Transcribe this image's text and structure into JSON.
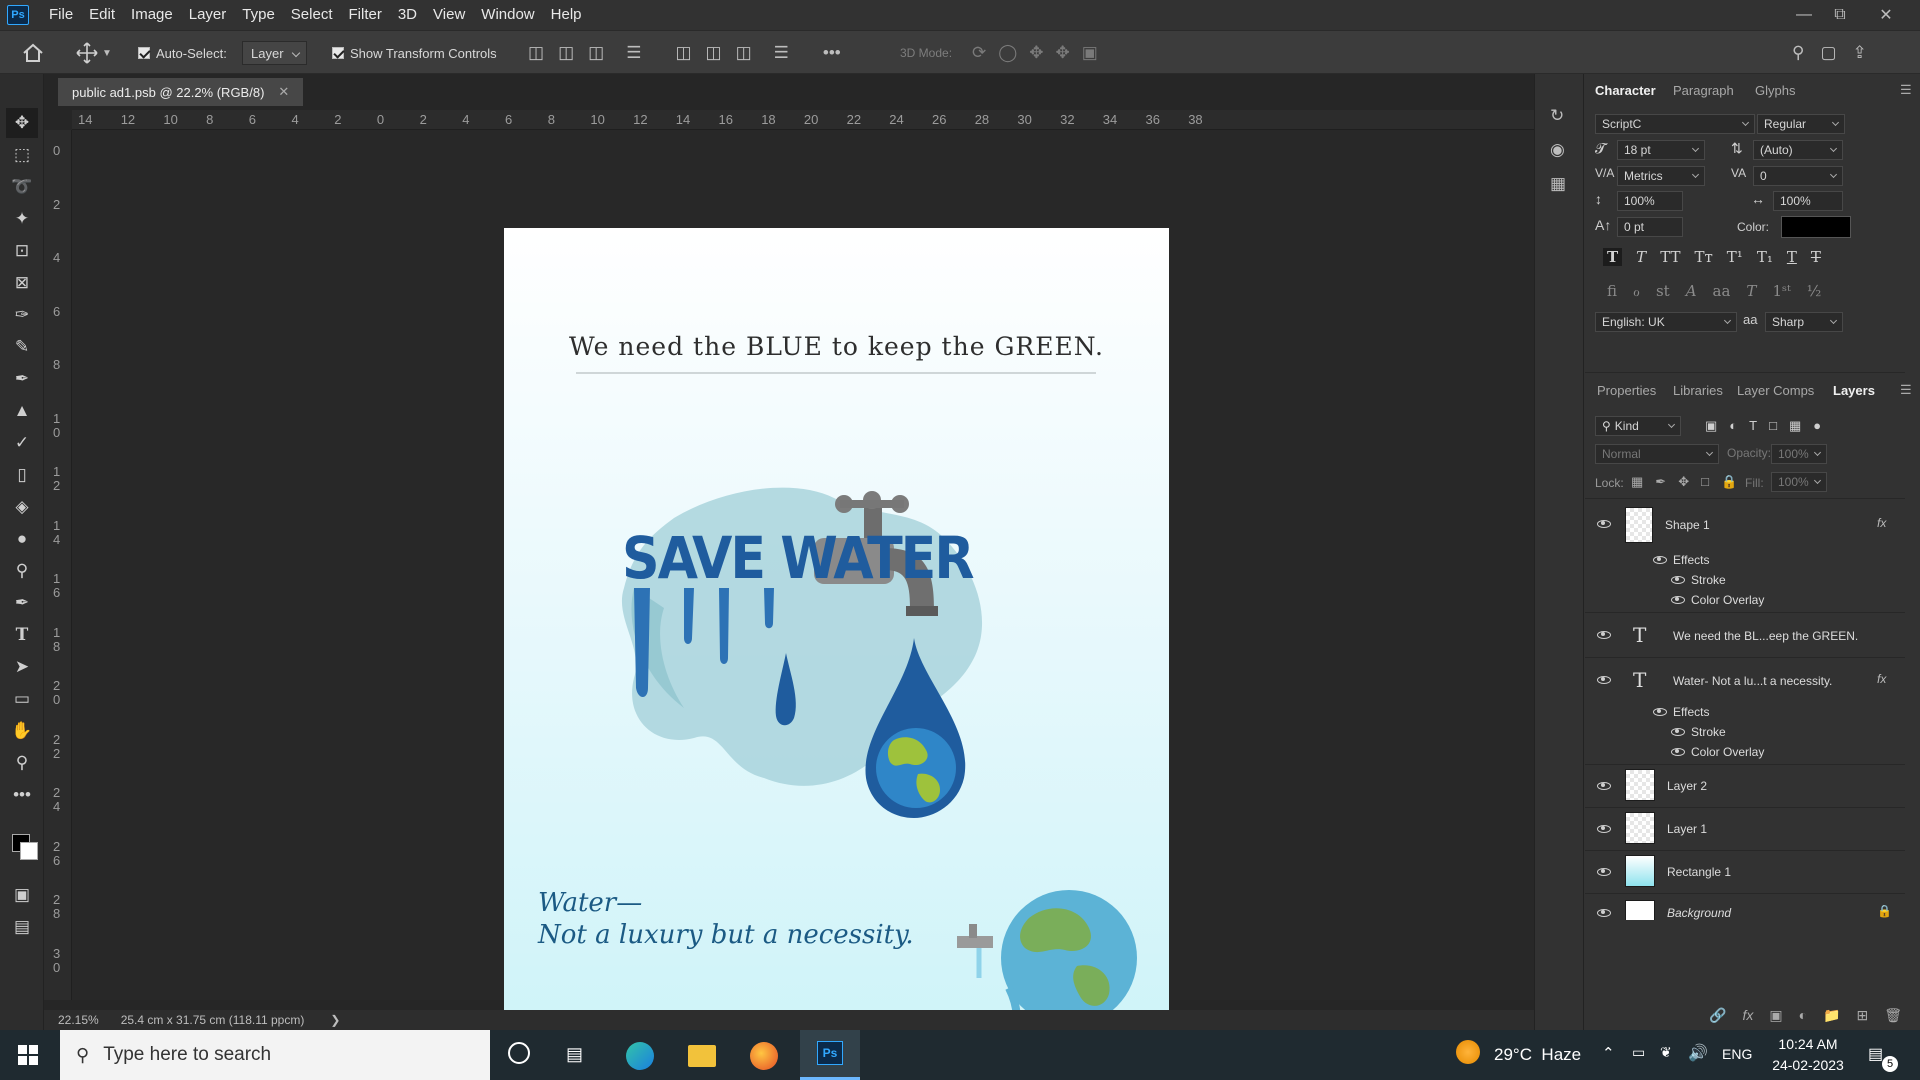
{
  "app": {
    "logo": "Ps",
    "menu": [
      "File",
      "Edit",
      "Image",
      "Layer",
      "Type",
      "Select",
      "Filter",
      "3D",
      "View",
      "Window",
      "Help"
    ]
  },
  "options": {
    "auto_select_label": "Auto-Select:",
    "auto_select_value": "Layer",
    "transform_label": "Show Transform Controls",
    "mode3d_label": "3D Mode:"
  },
  "document": {
    "tab_title": "public ad1.psb @ 22.2% (RGB/8)",
    "zoom": "22.15%",
    "size": "25.4 cm x 31.75 cm (118.11 ppcm)",
    "ruler_top": [
      "14",
      "12",
      "10",
      "8",
      "6",
      "4",
      "2",
      "0",
      "2",
      "4",
      "6",
      "8",
      "10",
      "12",
      "14",
      "16",
      "18",
      "20",
      "22",
      "24",
      "26",
      "28",
      "30",
      "32",
      "34",
      "36",
      "38"
    ],
    "ruler_left": [
      "0",
      "2",
      "4",
      "6",
      "8",
      "1\n0",
      "1\n2",
      "1\n4",
      "1\n6",
      "1\n8",
      "2\n0",
      "2\n2",
      "2\n4",
      "2\n6",
      "2\n8",
      "3\n0",
      "3"
    ]
  },
  "artwork": {
    "headline": "We need the BLUE to keep the GREEN.",
    "logo_text": "SAVE WATER",
    "tagline_1": "Water—",
    "tagline_2": "Not a luxury but a necessity."
  },
  "character": {
    "tabs": [
      "Character",
      "Paragraph",
      "Glyphs"
    ],
    "font_family": "ScriptC",
    "font_style": "Regular",
    "size": "18 pt",
    "leading": "(Auto)",
    "kerning": "Metrics",
    "tracking": "0",
    "vscale": "100%",
    "hscale": "100%",
    "baseline": "0 pt",
    "color_label": "Color:",
    "color": "#000000",
    "language": "English: UK",
    "aa_label": "aa",
    "antialias": "Sharp"
  },
  "layers_panel": {
    "tabs": [
      "Properties",
      "Libraries",
      "Layer Comps",
      "Layers"
    ],
    "filter": "Kind",
    "blend": "Normal",
    "opacity_label": "Opacity:",
    "opacity": "100%",
    "lock_label": "Lock:",
    "fill_label": "Fill:",
    "fill": "100%",
    "layers": [
      {
        "name": "Shape 1",
        "fx": "fx",
        "effects_label": "Effects",
        "effects": [
          "Stroke",
          "Color Overlay"
        ]
      },
      {
        "name": "We need the BL...eep the GREEN.",
        "type": "T"
      },
      {
        "name": "Water- Not a lu...t a necessity.",
        "type": "T",
        "fx": "fx",
        "effects_label": "Effects",
        "effects": [
          "Stroke",
          "Color Overlay"
        ]
      },
      {
        "name": "Layer 2"
      },
      {
        "name": "Layer 1"
      },
      {
        "name": "Rectangle 1"
      },
      {
        "name": "Background"
      }
    ]
  },
  "taskbar": {
    "search_placeholder": "Type here to search",
    "weather": "29°C  Haze",
    "lang": "ENG",
    "time": "10:24 AM",
    "date": "24-02-2023",
    "notif_count": "5"
  }
}
